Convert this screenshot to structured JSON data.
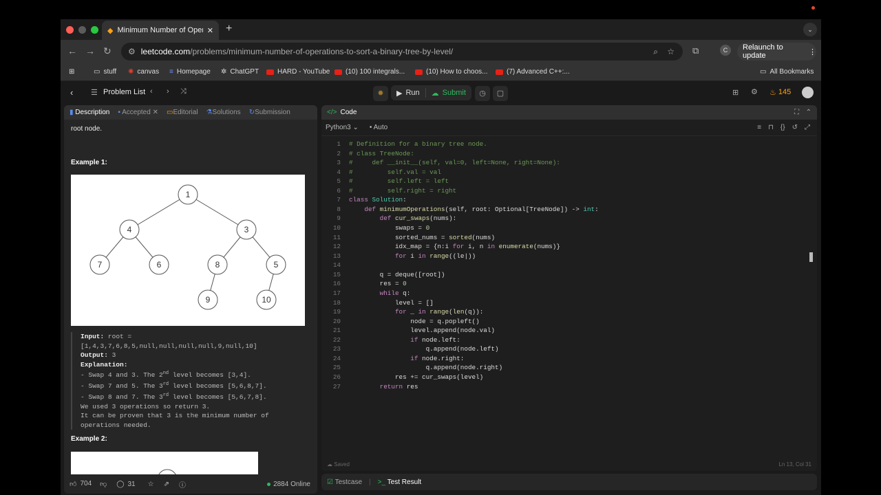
{
  "browser": {
    "tab_title": "Minimum Number of Operatio",
    "url_domain": "leetcode.com",
    "url_path": "/problems/minimum-number-of-operations-to-sort-a-binary-tree-by-level/",
    "relaunch_label": "Relaunch to update",
    "profile_initial": "C"
  },
  "bookmarks": [
    {
      "label": "stuff",
      "icon": "folder-icon"
    },
    {
      "label": "canvas",
      "icon": "canvas-icon"
    },
    {
      "label": "Homepage",
      "icon": "homepage-icon"
    },
    {
      "label": "ChatGPT",
      "icon": "chatgpt-icon"
    },
    {
      "label": "HARD - YouTube",
      "icon": "youtube-icon"
    },
    {
      "label": "(10) 100 integrals...",
      "icon": "youtube-icon"
    },
    {
      "label": "(10) How to choos...",
      "icon": "youtube-icon"
    },
    {
      "label": "(7) Advanced C++:...",
      "icon": "youtube-icon"
    }
  ],
  "all_bookmarks_label": "All Bookmarks",
  "leetcode": {
    "problem_list": "Problem List",
    "run": "Run",
    "submit": "Submit",
    "streak": "145"
  },
  "left_tabs": [
    "Description",
    "Accepted",
    "Editorial",
    "Solutions",
    "Submission"
  ],
  "description": {
    "root_text": "root node.",
    "example1": "Example 1:",
    "example2": "Example 2:",
    "input_label": "Input:",
    "input_value": "root =",
    "input_value2": "[1,4,3,7,6,8,5,null,null,null,null,9,null,10]",
    "output_label": "Output:",
    "output_value": "3",
    "explanation_label": "Explanation:",
    "exp1a": "- Swap 4 and 3. The 2",
    "exp1s": "nd",
    "exp1b": " level becomes [3,4].",
    "exp2a": "- Swap 7 and 5. The 3",
    "exp2s": "rd",
    "exp2b": " level becomes [5,6,8,7].",
    "exp3a": "- Swap 8 and 7. The 3",
    "exp3s": "rd",
    "exp3b": " level becomes [5,6,7,8].",
    "exp4": "We used 3 operations so return 3.",
    "exp5": "It can be proven that 3 is the minimum number of",
    "exp6": "operations needed."
  },
  "tree_nodes": [
    "1",
    "4",
    "3",
    "7",
    "6",
    "8",
    "5",
    "9",
    "10"
  ],
  "left_footer": {
    "likes": "704",
    "comments": "31",
    "online": "2884 Online"
  },
  "editor": {
    "title": "Code",
    "language": "Python3",
    "autocomplete": "Auto",
    "saved": "Saved",
    "cursor": "Ln 13, Col 31"
  },
  "console": {
    "testcase": "Testcase",
    "result": "Test Result"
  },
  "colors": {
    "accent_green": "#2cbb5d",
    "streak": "#ffa116",
    "comment": "#6a9955"
  }
}
